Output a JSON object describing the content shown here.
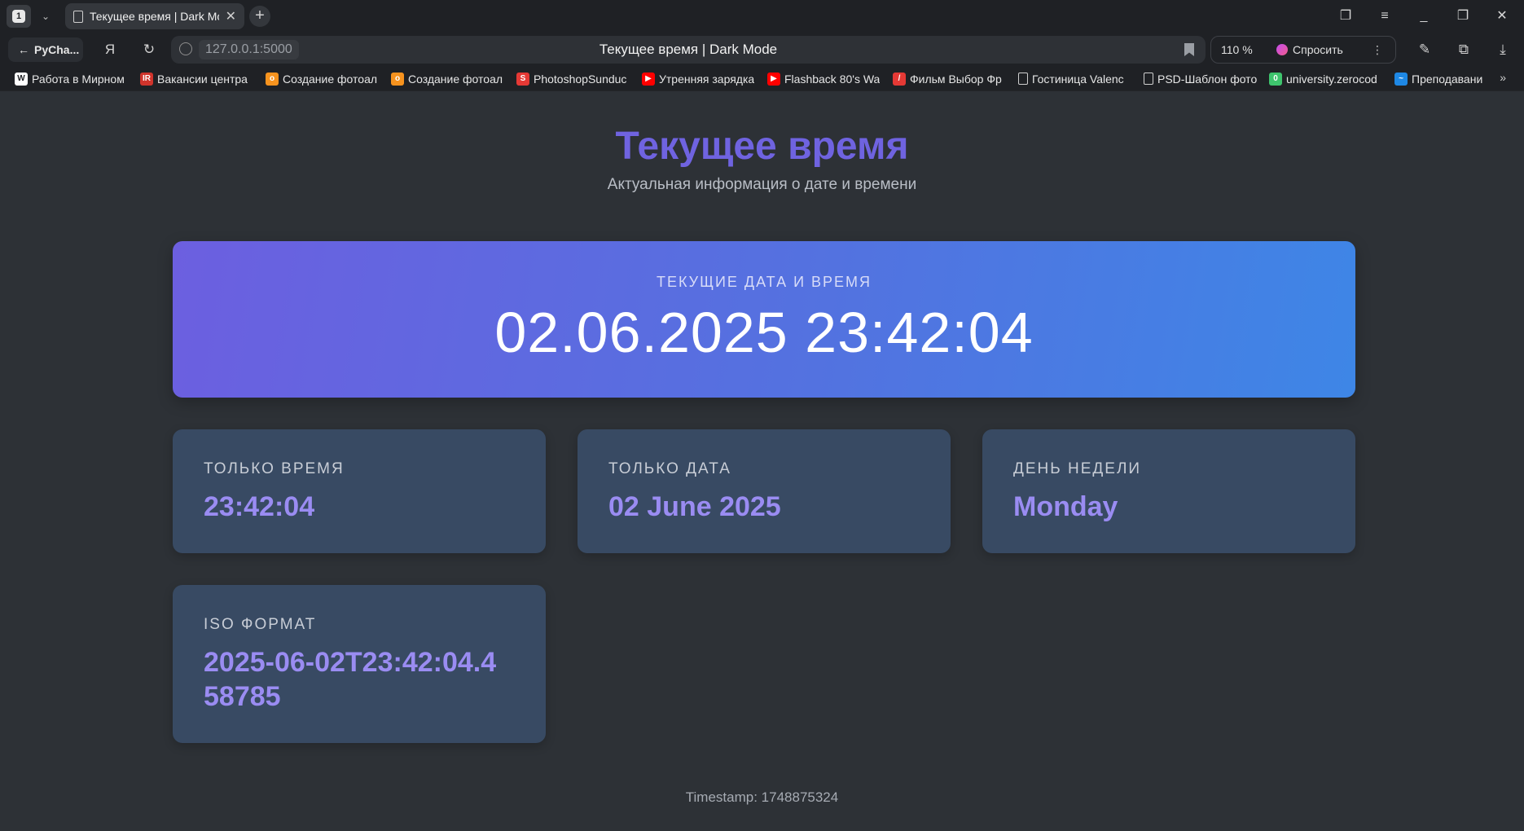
{
  "browser": {
    "tab_count": "1",
    "tab_title": "Текущее время | Dark Mode",
    "back_label": "PyCha...",
    "url": "127.0.0.1:5000",
    "page_title": "Текущее время | Dark Mode",
    "zoom": "110 %",
    "ask_label": "Спросить",
    "bookmarks": [
      {
        "label": "Работа в Мирном",
        "color": "#ffffff",
        "glyph": "W"
      },
      {
        "label": "Вакансии центра",
        "color": "#d0342c",
        "glyph": "IR"
      },
      {
        "label": "Создание фотоал",
        "color": "#f7931e",
        "glyph": "o"
      },
      {
        "label": "Создание фотоал",
        "color": "#f7931e",
        "glyph": "o"
      },
      {
        "label": "PhotoshopSunduc",
        "color": "#e53935",
        "glyph": "S"
      },
      {
        "label": "Утренняя зарядка",
        "color": "#ff0000",
        "glyph": "▶"
      },
      {
        "label": "Flashback 80's Wa",
        "color": "#ff0000",
        "glyph": "▶"
      },
      {
        "label": "Фильм Выбор Фр",
        "color": "#e53935",
        "glyph": "/"
      },
      {
        "label": "Гостиница Valenc",
        "color": "transparent",
        "glyph": ""
      },
      {
        "label": "PSD-Шаблон фото",
        "color": "transparent",
        "glyph": ""
      },
      {
        "label": "university.zerocod",
        "color": "#3ec46d",
        "glyph": "0"
      },
      {
        "label": "Преподавани",
        "color": "#1e88e5",
        "glyph": "~"
      }
    ],
    "bookmarks_more": "»"
  },
  "header": {
    "title": "Текущее время",
    "subtitle": "Актуальная информация о дате и времени"
  },
  "main_card": {
    "label": "ТЕКУЩИЕ ДАТА И ВРЕМЯ",
    "value": "02.06.2025 23:42:04"
  },
  "cards": [
    {
      "label": "ТОЛЬКО ВРЕМЯ",
      "value": "23:42:04"
    },
    {
      "label": "ТОЛЬКО ДАТА",
      "value": "02 June 2025"
    },
    {
      "label": "ДЕНЬ НЕДЕЛИ",
      "value": "Monday"
    },
    {
      "label": "ISO ФОРМАТ",
      "value": "2025-06-02T23:42:04.458785"
    }
  ],
  "footer": {
    "text": "Timestamp: 1748875324"
  },
  "colors": {
    "accent": "#6f63e0",
    "card_bg": "#384a63",
    "value_text": "#9a8cf2",
    "page_bg": "#2d3136"
  }
}
